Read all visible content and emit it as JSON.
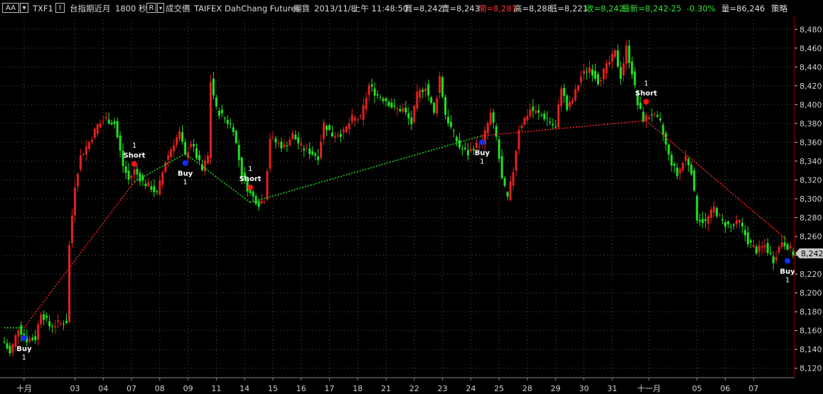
{
  "header": {
    "aa_label": "AA",
    "symbol": "TXF1",
    "i_label": "I",
    "name": "台指期近月",
    "interval": "1800 秒",
    "r_label": "R",
    "price_type": "成交價",
    "exchange": "TAIFEX",
    "broker": "DahChang Futures",
    "market": "期貨",
    "date": "2013/11/8",
    "time": "上午 11:48:50",
    "bid": "買=8,242",
    "ask": "賣=8,243",
    "open": "開=8,281",
    "high": "高=8,288",
    "low": "低=8,221",
    "close": "收=8,242",
    "last": "最新=8,242",
    "change": "-25",
    "change_pct": "-0.30%",
    "volume": "量=86,246",
    "strategy": "策略"
  },
  "colors": {
    "background": "#000000",
    "up_candle": "#e02020",
    "down_candle": "#20e020",
    "grid": "#555555",
    "axis": "#d0d0d0",
    "buy_marker": "#1030ff",
    "short_marker": "#ff1010",
    "price_badge": "#c8c8c8"
  },
  "chart_data": {
    "type": "candlestick",
    "title": "",
    "xlabel": "",
    "ylabel": "",
    "ylim": [
      8110,
      8490
    ],
    "y_ticks": [
      8120,
      8140,
      8160,
      8180,
      8200,
      8220,
      8240,
      8260,
      8280,
      8300,
      8320,
      8340,
      8360,
      8380,
      8400,
      8420,
      8440,
      8460,
      8480
    ],
    "y_tick_labels": [
      "8,120",
      "8,140",
      "8,160",
      "8,180",
      "8,200",
      "8,220",
      "8,240",
      "8,260",
      "8,280",
      "8,300",
      "8,320",
      "8,340",
      "8,360",
      "8,380",
      "8,400",
      "8,420",
      "8,440",
      "8,460",
      "8,480"
    ],
    "last_price": 8242,
    "last_price_label": "8,242",
    "bar_count": 280,
    "x_labels": [
      {
        "label": "十月",
        "bar": 7
      },
      {
        "label": "03",
        "bar": 25
      },
      {
        "label": "04",
        "bar": 35
      },
      {
        "label": "07",
        "bar": 45
      },
      {
        "label": "08",
        "bar": 55
      },
      {
        "label": "09",
        "bar": 65
      },
      {
        "label": "11",
        "bar": 75
      },
      {
        "label": "14",
        "bar": 85
      },
      {
        "label": "15",
        "bar": 95
      },
      {
        "label": "16",
        "bar": 105
      },
      {
        "label": "17",
        "bar": 115
      },
      {
        "label": "18",
        "bar": 125
      },
      {
        "label": "21",
        "bar": 135
      },
      {
        "label": "22",
        "bar": 145
      },
      {
        "label": "23",
        "bar": 155
      },
      {
        "label": "24",
        "bar": 165
      },
      {
        "label": "25",
        "bar": 175
      },
      {
        "label": "28",
        "bar": 185
      },
      {
        "label": "29",
        "bar": 195
      },
      {
        "label": "30",
        "bar": 205
      },
      {
        "label": "31",
        "bar": 215
      },
      {
        "label": "十一月",
        "bar": 228
      },
      {
        "label": "05",
        "bar": 245
      },
      {
        "label": "06",
        "bar": 255
      },
      {
        "label": "07",
        "bar": 265
      }
    ],
    "signals": [
      {
        "type": "Buy",
        "bar": 7,
        "price": 8152,
        "qty": "1"
      },
      {
        "type": "Short",
        "bar": 46,
        "price": 8337,
        "qty": "1"
      },
      {
        "type": "Buy",
        "bar": 64,
        "price": 8338,
        "qty": "1"
      },
      {
        "type": "Short",
        "bar": 87,
        "price": 8312,
        "qty": "1"
      },
      {
        "type": "Buy",
        "bar": 169,
        "price": 8360,
        "qty": "1"
      },
      {
        "type": "Short",
        "bar": 227,
        "price": 8403,
        "qty": "1"
      },
      {
        "type": "Buy",
        "bar": 277,
        "price": 8234,
        "qty": "1"
      }
    ],
    "trade_lines": [
      {
        "color": "#20e020",
        "from": [
          0,
          8163
        ],
        "to": [
          7,
          8163
        ]
      },
      {
        "color": "#ff2020",
        "from": [
          7,
          8163
        ],
        "to": [
          46,
          8318
        ]
      },
      {
        "color": "#20e020",
        "from": [
          46,
          8318
        ],
        "to": [
          64,
          8348
        ]
      },
      {
        "color": "#20e020",
        "from": [
          64,
          8348
        ],
        "to": [
          87,
          8296
        ]
      },
      {
        "color": "#20e020",
        "from": [
          87,
          8296
        ],
        "to": [
          169,
          8367
        ]
      },
      {
        "color": "#ff2020",
        "from": [
          169,
          8367
        ],
        "to": [
          227,
          8383
        ]
      },
      {
        "color": "#ff2020",
        "from": [
          227,
          8383
        ],
        "to": [
          277,
          8256
        ]
      }
    ],
    "path_anchors": [
      [
        0,
        8148
      ],
      [
        2,
        8135
      ],
      [
        5,
        8163
      ],
      [
        8,
        8150
      ],
      [
        11,
        8152
      ],
      [
        13,
        8180
      ],
      [
        16,
        8165
      ],
      [
        20,
        8168
      ],
      [
        22,
        8170
      ],
      [
        23,
        8250
      ],
      [
        25,
        8315
      ],
      [
        27,
        8345
      ],
      [
        30,
        8360
      ],
      [
        33,
        8378
      ],
      [
        36,
        8385
      ],
      [
        39,
        8380
      ],
      [
        42,
        8335
      ],
      [
        44,
        8320
      ],
      [
        46,
        8330
      ],
      [
        49,
        8318
      ],
      [
        52,
        8312
      ],
      [
        54,
        8305
      ],
      [
        57,
        8340
      ],
      [
        60,
        8360
      ],
      [
        62,
        8370
      ],
      [
        64,
        8345
      ],
      [
        66,
        8360
      ],
      [
        68,
        8345
      ],
      [
        70,
        8330
      ],
      [
        72,
        8345
      ],
      [
        73,
        8425
      ],
      [
        75,
        8395
      ],
      [
        78,
        8385
      ],
      [
        81,
        8375
      ],
      [
        84,
        8325
      ],
      [
        87,
        8305
      ],
      [
        90,
        8295
      ],
      [
        92,
        8300
      ],
      [
        94,
        8365
      ],
      [
        96,
        8360
      ],
      [
        99,
        8355
      ],
      [
        102,
        8368
      ],
      [
        105,
        8355
      ],
      [
        108,
        8350
      ],
      [
        111,
        8345
      ],
      [
        113,
        8380
      ],
      [
        116,
        8368
      ],
      [
        120,
        8370
      ],
      [
        123,
        8385
      ],
      [
        126,
        8385
      ],
      [
        129,
        8420
      ],
      [
        132,
        8410
      ],
      [
        135,
        8405
      ],
      [
        138,
        8395
      ],
      [
        141,
        8395
      ],
      [
        144,
        8380
      ],
      [
        146,
        8410
      ],
      [
        149,
        8420
      ],
      [
        152,
        8390
      ],
      [
        154,
        8430
      ],
      [
        156,
        8390
      ],
      [
        158,
        8375
      ],
      [
        161,
        8355
      ],
      [
        164,
        8348
      ],
      [
        166,
        8355
      ],
      [
        169,
        8360
      ],
      [
        172,
        8390
      ],
      [
        174,
        8365
      ],
      [
        176,
        8320
      ],
      [
        178,
        8300
      ],
      [
        180,
        8330
      ],
      [
        182,
        8375
      ],
      [
        184,
        8385
      ],
      [
        186,
        8395
      ],
      [
        189,
        8390
      ],
      [
        192,
        8385
      ],
      [
        195,
        8375
      ],
      [
        197,
        8420
      ],
      [
        199,
        8395
      ],
      [
        201,
        8405
      ],
      [
        204,
        8430
      ],
      [
        207,
        8440
      ],
      [
        210,
        8425
      ],
      [
        213,
        8440
      ],
      [
        216,
        8455
      ],
      [
        218,
        8430
      ],
      [
        220,
        8460
      ],
      [
        222,
        8435
      ],
      [
        224,
        8400
      ],
      [
        226,
        8385
      ],
      [
        229,
        8390
      ],
      [
        232,
        8380
      ],
      [
        235,
        8345
      ],
      [
        238,
        8325
      ],
      [
        241,
        8345
      ],
      [
        243,
        8330
      ],
      [
        245,
        8280
      ],
      [
        248,
        8275
      ],
      [
        251,
        8290
      ],
      [
        254,
        8275
      ],
      [
        257,
        8270
      ],
      [
        260,
        8275
      ],
      [
        263,
        8255
      ],
      [
        266,
        8245
      ],
      [
        269,
        8250
      ],
      [
        272,
        8235
      ],
      [
        275,
        8255
      ],
      [
        277,
        8250
      ],
      [
        279,
        8242
      ]
    ]
  }
}
